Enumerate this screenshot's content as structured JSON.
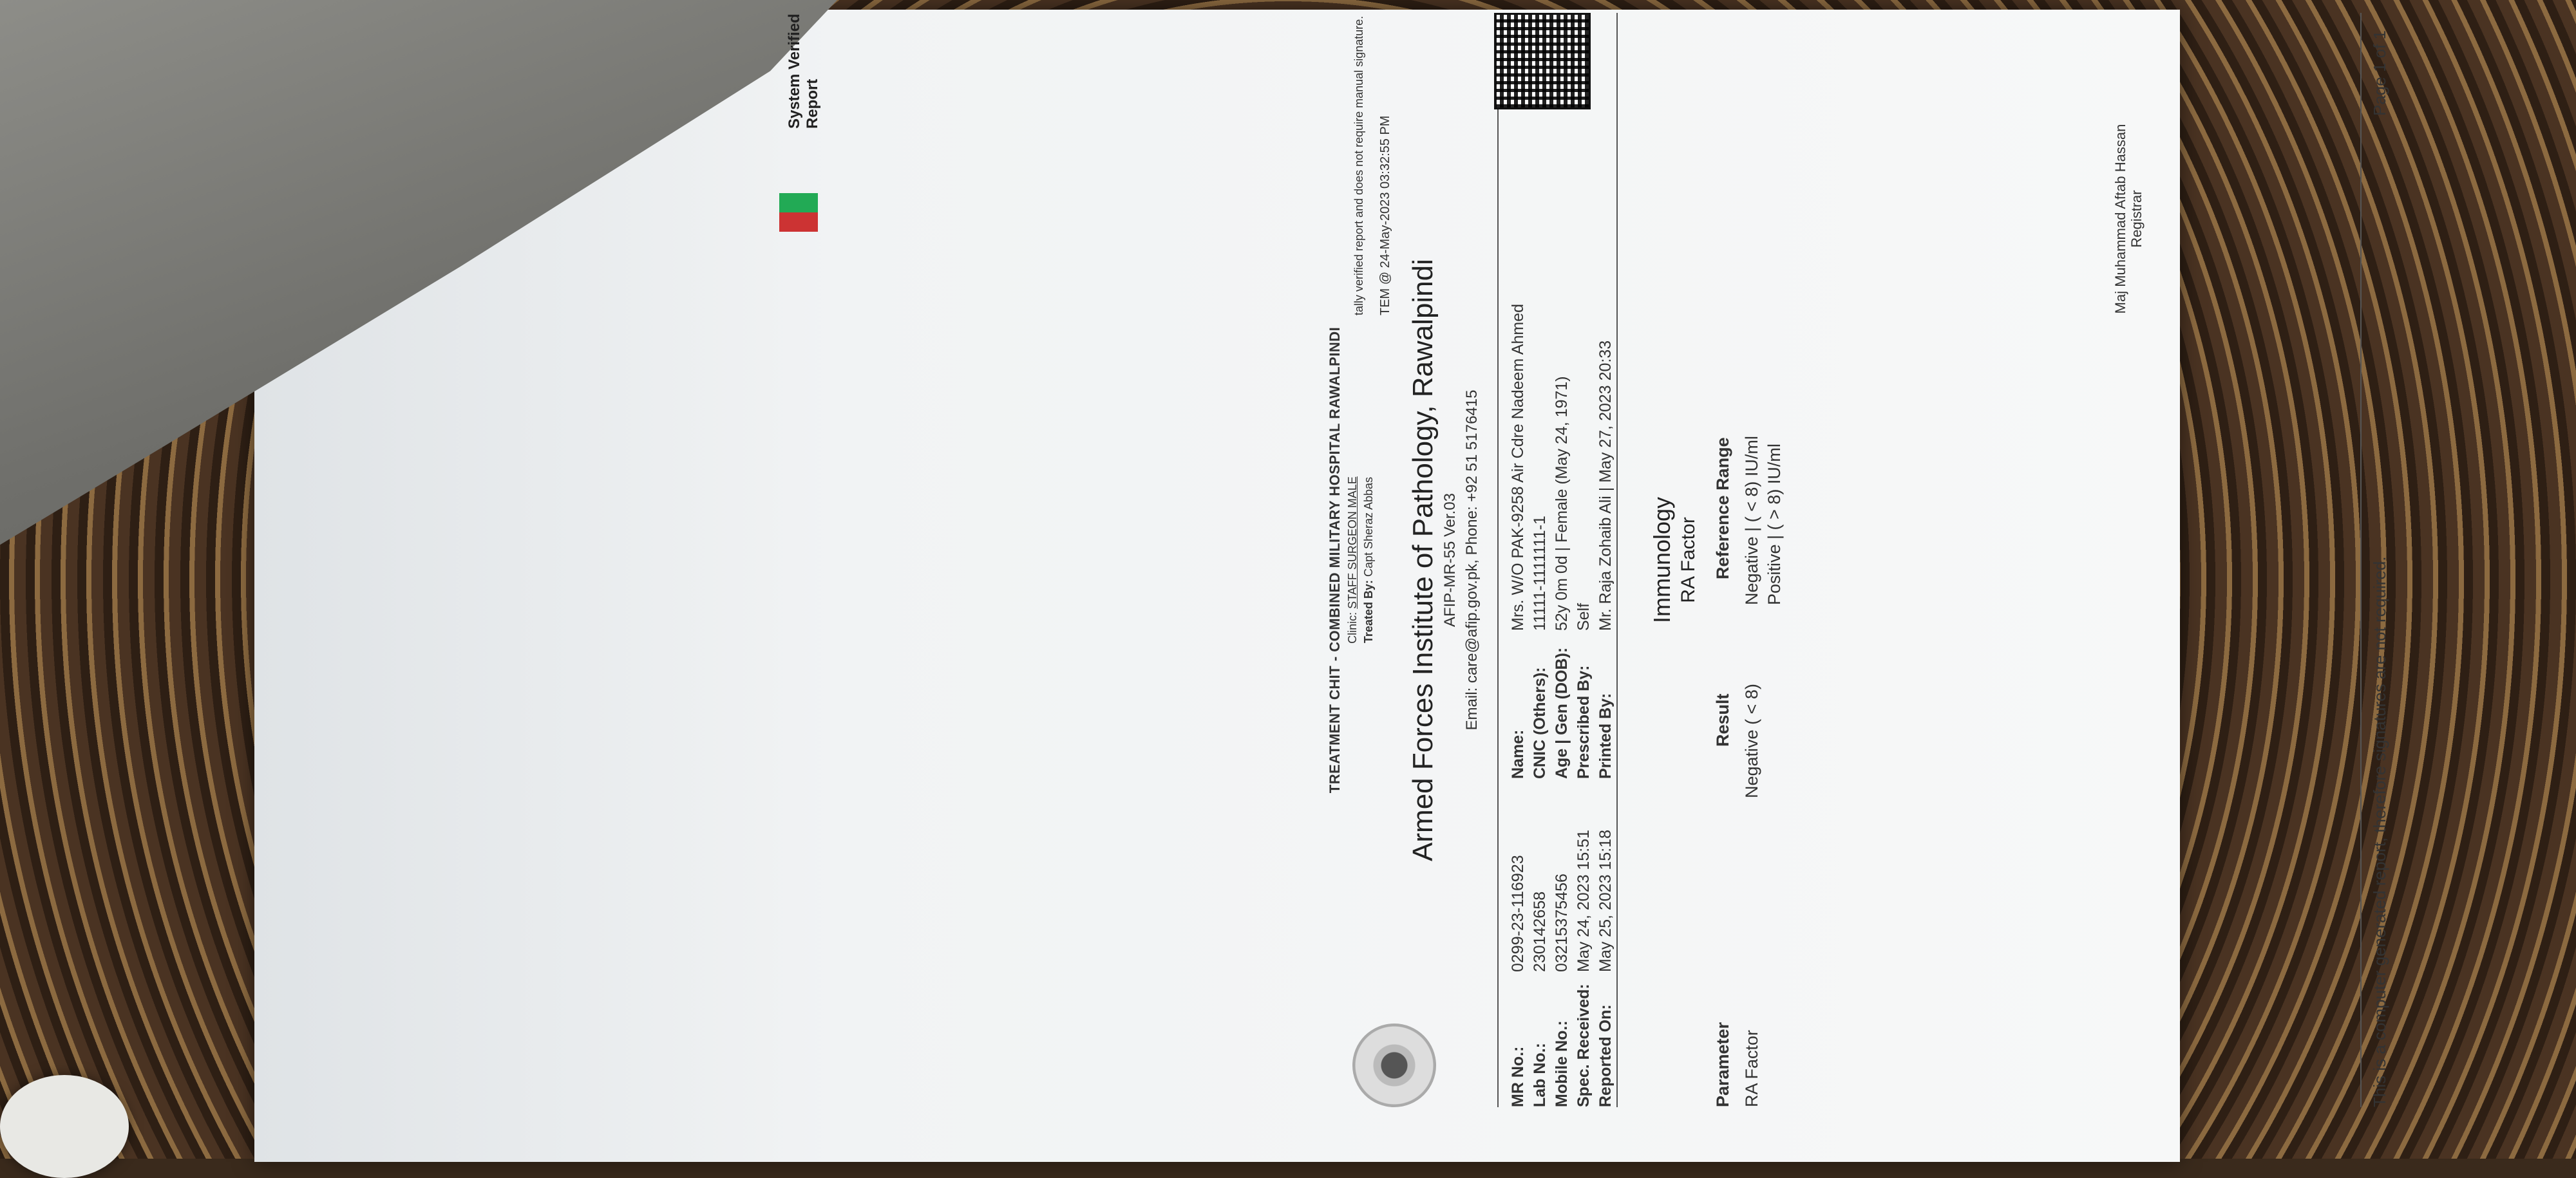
{
  "header": {
    "chit_title": "TREATMENT CHIT - COMBINED MILITARY HOSPITAL RAWALPINDI",
    "clinic_label": "Clinic:",
    "clinic_value": "STAFF SURGEON MALE",
    "treated_by_label": "Treated By:",
    "treated_by_value": "Capt Sheraz Abbas"
  },
  "institute": {
    "title": "Armed Forces Institute of Pathology, Rawalpindi",
    "form_code": "AFIP-MR-55 Ver.03",
    "contact": "Email: care@afip.gov.pk, Phone: +92 51 5176415"
  },
  "patient": {
    "left": [
      {
        "label": "MR No.:",
        "value": "0299-23-116923"
      },
      {
        "label": "Lab No.:",
        "value": "230142658"
      },
      {
        "label": "Mobile No.:",
        "value": "03215375456"
      },
      {
        "label": "Spec. Received:",
        "value": "May 24, 2023 15:51"
      },
      {
        "label": "Reported On:",
        "value": "May 25, 2023 15:18"
      }
    ],
    "right": [
      {
        "label": "Name:",
        "value": "Mrs.  W/O PAK-9258 Air Cdre Nadeem Ahmed"
      },
      {
        "label": "CNIC (Others):",
        "value": "11111-1111111-1"
      },
      {
        "label": "Age | Gen (DOB):",
        "value": "52y 0m 0d | Female (May 24, 1971)"
      },
      {
        "label": "Prescribed By:",
        "value": "Self"
      },
      {
        "label": "Printed By:",
        "value": "Mr. Raja Zohaib Ali | May 27, 2023 20:33"
      }
    ]
  },
  "section": {
    "department": "Immunology",
    "test_group": "RA Factor"
  },
  "results": {
    "headers": {
      "parameter": "Parameter",
      "result": "Result",
      "reference": "Reference Range"
    },
    "rows": [
      {
        "parameter": "RA Factor",
        "result": "Negative ( < 8)",
        "reference_1": "Negative | ( < 8) IU/ml",
        "reference_2": "Positive | ( > 8) IU/ml"
      }
    ]
  },
  "signature": {
    "name": "Maj Muhammad Aftab Hassan",
    "role": "Registrar"
  },
  "footer": {
    "note": "This is a computer generated report, therefore signatures are not required.",
    "page": "Page 1 of 1",
    "verified_label": "System Verified Report",
    "verified_note": "tally verified report and does not require manual signature.",
    "verified_time": "TEM @ 24-May-2023 03:32:55 PM"
  }
}
